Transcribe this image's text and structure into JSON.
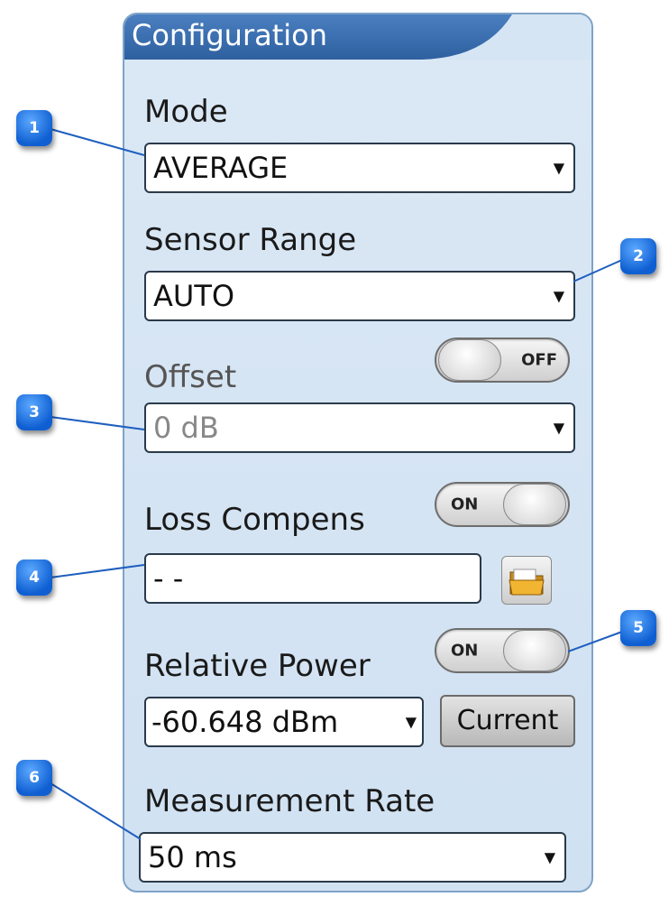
{
  "panel": {
    "title": "Configuration"
  },
  "mode": {
    "label": "Mode",
    "value": "AVERAGE"
  },
  "sensor_range": {
    "label": "Sensor Range",
    "value": "AUTO"
  },
  "offset": {
    "label": "Offset",
    "toggle_state": "OFF",
    "value": "0 dB"
  },
  "loss_compens": {
    "label": "Loss Compens",
    "toggle_state": "ON",
    "file_value": "- -",
    "file_icon": "folder-icon"
  },
  "relative_power": {
    "label": "Relative Power",
    "toggle_state": "ON",
    "value": "-60.648 dBm",
    "current_label": "Current"
  },
  "measurement_rate": {
    "label": "Measurement Rate",
    "value": "50 ms"
  },
  "callouts": [
    "1",
    "2",
    "3",
    "4",
    "5",
    "6"
  ],
  "icons": {
    "dropdown_arrow": "▼"
  },
  "colors": {
    "panel_bg": "#d6e5f4",
    "title_bar": "#3a6fb0",
    "callout": "#1a6fe0"
  }
}
